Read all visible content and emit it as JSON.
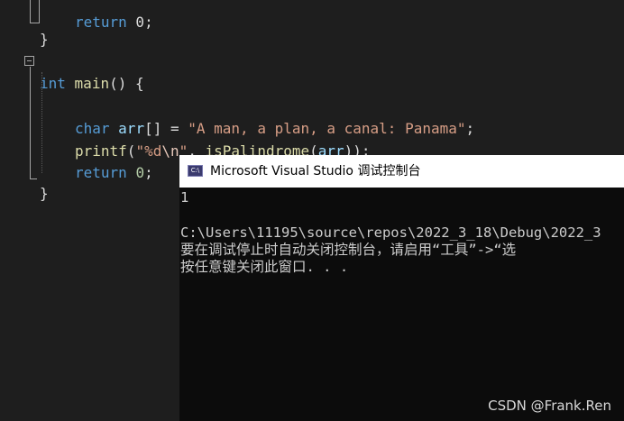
{
  "editor": {
    "top_line": {
      "kw": "return",
      "rest": " 0;"
    },
    "close_brace_1": "}",
    "main_sig": {
      "kw": "int",
      "name": "main",
      "punct": "() {"
    },
    "line_char": {
      "kw": "char",
      "var": "arr",
      "mid": "[] = ",
      "str_open": "\"A man, a plan, a canal: Panama\"",
      "end": ";"
    },
    "line_printf": {
      "fn": "printf",
      "open": "(",
      "str_a": "\"%d",
      "esc": "\\n",
      "str_b": "\"",
      "comma": ", ",
      "fn2": "isPalindrome",
      "open2": "(",
      "var": "arr",
      "end": "));"
    },
    "line_return": {
      "kw": "return",
      "sp": " ",
      "num": "0",
      "end": ";"
    },
    "close_brace_2": "}"
  },
  "console": {
    "title": "Microsoft Visual Studio 调试控制台",
    "icon_text": "C:\\",
    "lines": [
      "1",
      "",
      "C:\\Users\\11195\\source\\repos\\2022_3_18\\Debug\\2022_3",
      "要在调试停止时自动关闭控制台，请启用“工具”->“选",
      "按任意键关闭此窗口. . ."
    ]
  },
  "watermark": "CSDN @Frank.Ren"
}
